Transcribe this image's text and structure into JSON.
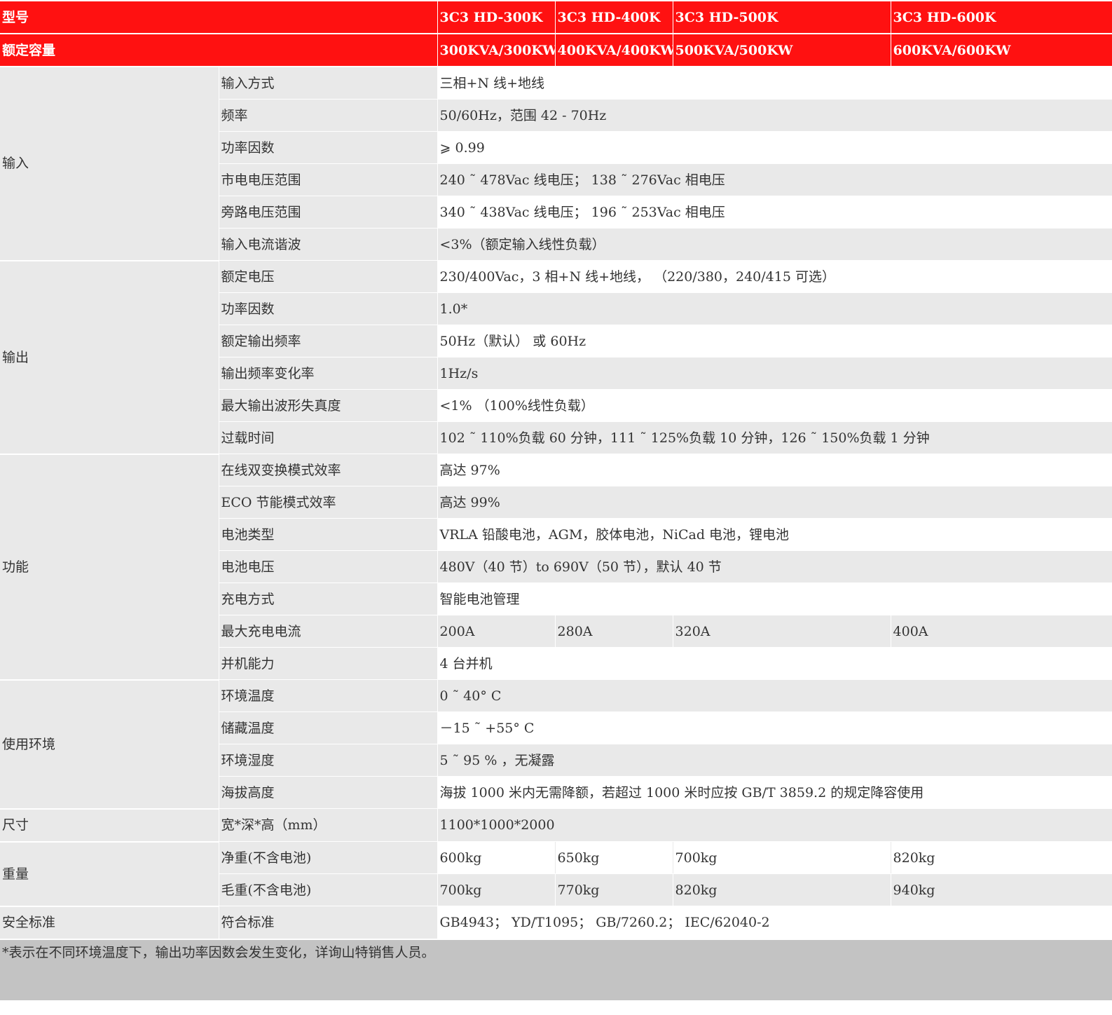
{
  "header": {
    "model_label": "型号",
    "models": [
      "3C3 HD-300K",
      "3C3 HD-400K",
      "3C3 HD-500K",
      "3C3 HD-600K"
    ],
    "capacity_label": "额定容量",
    "capacities": [
      "300KVA/300KW",
      "400KVA/400KW",
      "500KVA/500KW",
      "600KVA/600KW"
    ]
  },
  "input": {
    "label": "输入",
    "rows": [
      {
        "param": "输入方式",
        "value": "三相+N 线+地线"
      },
      {
        "param": "频率",
        "value": "50/60Hz，范围 42 - 70Hz"
      },
      {
        "param": "功率因数",
        "value": "⩾ 0.99"
      },
      {
        "param": "市电电压范围",
        "value": "240 ˜ 478Vac 线电压； 138 ˜ 276Vac 相电压"
      },
      {
        "param": "旁路电压范围",
        "value": "340 ˜ 438Vac 线电压； 196 ˜ 253Vac 相电压"
      },
      {
        "param": "输入电流谐波",
        "value": "<3%（额定输入线性负载）"
      }
    ]
  },
  "output": {
    "label": "输出",
    "rows": [
      {
        "param": "额定电压",
        "value": "230/400Vac，3 相+N 线+地线， （220/380，240/415 可选）"
      },
      {
        "param": "功率因数",
        "value": "1.0*"
      },
      {
        "param": "额定输出频率",
        "value": "50Hz（默认） 或 60Hz"
      },
      {
        "param": "输出频率变化率",
        "value": "1Hz/s"
      },
      {
        "param": "最大输出波形失真度",
        "value": "<1% （100%线性负载）"
      },
      {
        "param": "过载时间",
        "value": "102 ˜ 110%负载 60 分钟，111 ˜ 125%负载 10 分钟，126 ˜ 150%负载 1 分钟"
      }
    ]
  },
  "function": {
    "label": "功能",
    "rows": [
      {
        "param": "在线双变换模式效率",
        "value": "高达 97%"
      },
      {
        "param": "ECO 节能模式效率",
        "value": "高达 99%"
      },
      {
        "param": "电池类型",
        "value": "VRLA 铅酸电池，AGM，胶体电池，NiCad 电池，锂电池"
      },
      {
        "param": "电池电压",
        "value": "480V（40 节）to 690V（50 节），默认 40 节"
      },
      {
        "param": "充电方式",
        "value": "智能电池管理"
      },
      {
        "param": "最大充电电流",
        "values": [
          "200A",
          "280A",
          "320A",
          "400A"
        ]
      },
      {
        "param": "并机能力",
        "value": "4 台并机"
      }
    ]
  },
  "environment": {
    "label": "使用环境",
    "rows": [
      {
        "param": "环境温度",
        "value": "0 ˜ 40° C"
      },
      {
        "param": "储藏温度",
        "value": "－15 ˜ +55° C"
      },
      {
        "param": "环境湿度",
        "value": "5 ˜ 95 % ，无凝露"
      },
      {
        "param": "海拔高度",
        "value": "海拔 1000 米内无需降额，若超过 1000 米时应按 GB/T 3859.2 的规定降容使用"
      }
    ]
  },
  "size": {
    "label": "尺寸",
    "rows": [
      {
        "param": "宽*深*高（mm）",
        "value": "1100*1000*2000"
      }
    ]
  },
  "weight": {
    "label": "重量",
    "rows": [
      {
        "param": "净重(不含电池)",
        "values": [
          "600kg",
          "650kg",
          "700kg",
          "820kg"
        ]
      },
      {
        "param": "毛重(不含电池)",
        "values": [
          "700kg",
          "770kg",
          "820kg",
          "940kg"
        ]
      }
    ]
  },
  "safety": {
    "label": "安全标准",
    "rows": [
      {
        "param": "符合标准",
        "value": "GB4943； YD/T1095； GB/7260.2； IEC/62040-2"
      }
    ]
  },
  "footnote": "*表示在不同环境温度下，输出功率因数会发生变化，详询山特销售人员。"
}
